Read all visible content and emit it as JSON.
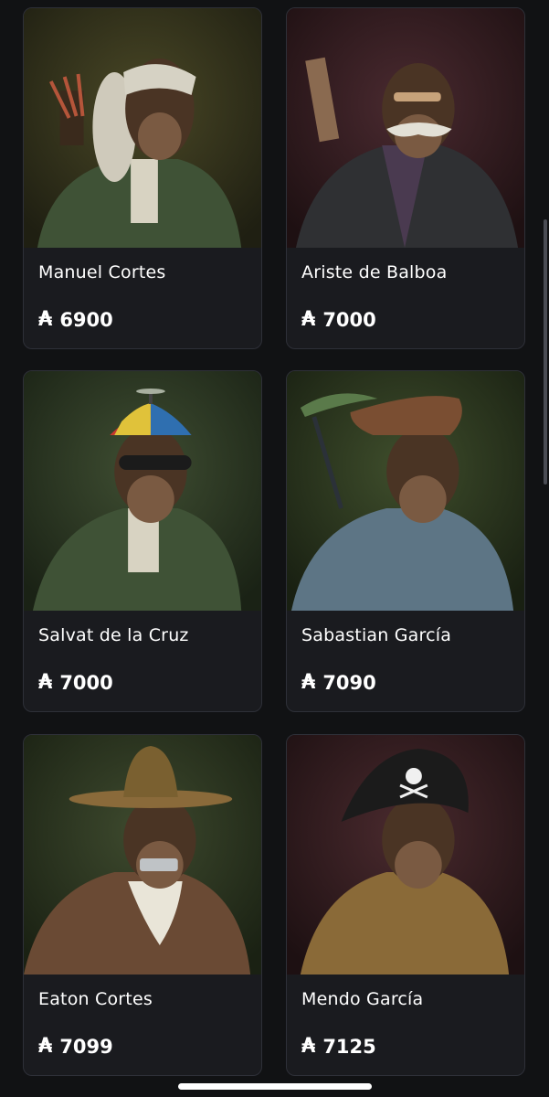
{
  "currency_symbol": "₳",
  "items": [
    {
      "name": "Manuel Cortes",
      "price": "6900"
    },
    {
      "name": "Ariste de Balboa",
      "price": "7000"
    },
    {
      "name": "Salvat de la Cruz",
      "price": "7000"
    },
    {
      "name": "Sabastian García",
      "price": "7090"
    },
    {
      "name": "Eaton Cortes",
      "price": "7099"
    },
    {
      "name": "Mendo García",
      "price": "7125"
    }
  ],
  "colors": {
    "background": "#111214",
    "card": "#1a1b1f",
    "card_border": "#2e3038",
    "text": "#ffffff"
  },
  "artwork": [
    {
      "icon": "monkey-wig-quiver-portrait-icon",
      "backdrop": "#3a3a1e"
    },
    {
      "icon": "monkey-mustache-suit-portrait-icon",
      "backdrop": "#3b2228"
    },
    {
      "icon": "monkey-propeller-cap-portrait-icon",
      "backdrop": "#2d3a24"
    },
    {
      "icon": "monkey-feather-hat-portrait-icon",
      "backdrop": "#2e3a22"
    },
    {
      "icon": "monkey-sombrero-portrait-icon",
      "backdrop": "#2f3a25"
    },
    {
      "icon": "monkey-pirate-hat-portrait-icon",
      "backdrop": "#3b2426"
    }
  ]
}
